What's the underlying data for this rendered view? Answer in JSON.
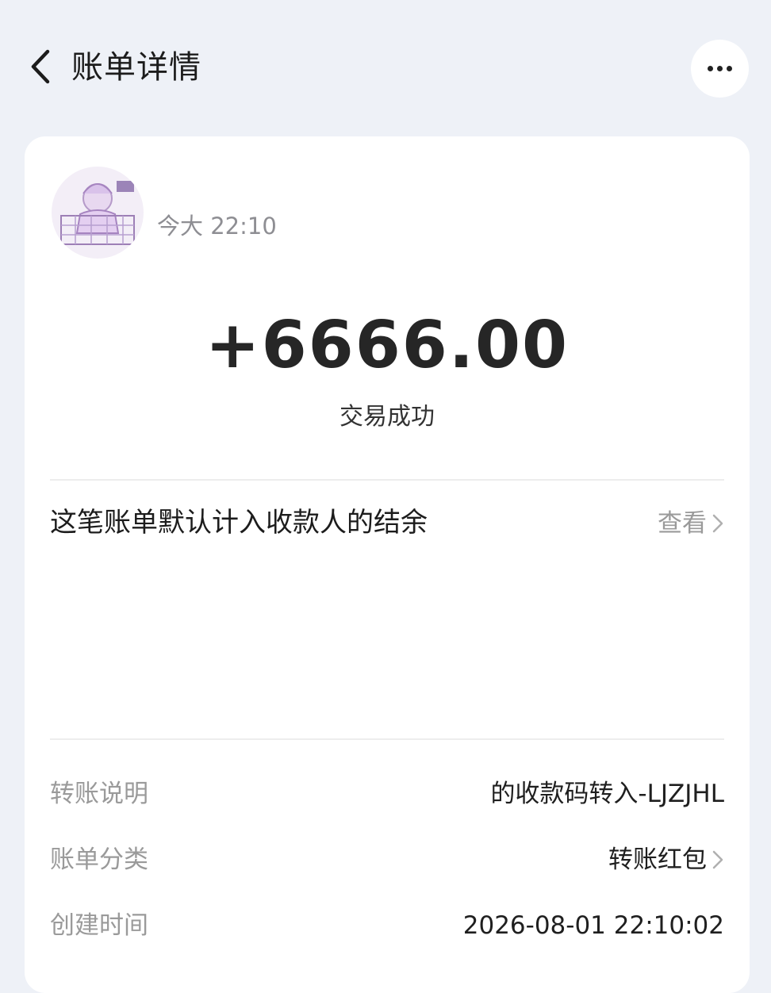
{
  "header": {
    "title": "账单详情",
    "back_icon": "chevron-left-icon",
    "more_icon": "more-horizontal-icon"
  },
  "transaction": {
    "time": "今大 22:10",
    "amount": "+6666.00",
    "status": "交易成功"
  },
  "balance_notice": {
    "text": "这笔账单默认计入收款人的结余",
    "link_label": "查看"
  },
  "details": [
    {
      "label": "转账说明",
      "value": "的收款码转入-LJZJHL"
    },
    {
      "label": "账单分类",
      "value": "转账红包"
    },
    {
      "label": "创建时间",
      "value": "2026-08-01 22:10:02"
    }
  ],
  "colors": {
    "background": "#eef1f7",
    "card": "#ffffff",
    "muted_text": "#9a9a9a",
    "amount_text": "#262626"
  }
}
